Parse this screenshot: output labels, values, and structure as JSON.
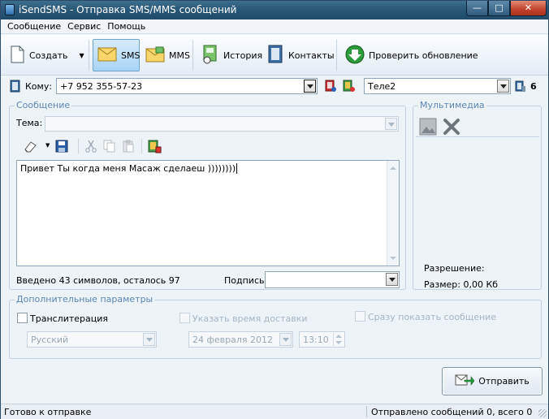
{
  "window": {
    "title": "iSendSMS - Отправка SMS/MMS сообщений",
    "controls": [
      "minimize-icon",
      "maximize-icon",
      "close-icon"
    ]
  },
  "menu": [
    "Сообщение",
    "Сервис",
    "Помощь"
  ],
  "toolbar": {
    "create": "Создать",
    "sms": "SMS",
    "mms": "MMS",
    "history": "История",
    "contacts": "Контакты",
    "update": "Проверить обновление"
  },
  "recipient": {
    "label": "Кому:",
    "value": "+7 952 355-57-23",
    "operator": "Теле2",
    "count": "6"
  },
  "message": {
    "group_title": "Сообщение",
    "subject_label": "Тема:",
    "subject_value": "",
    "text": "Привет Ты когда меня Масаж сделаеш ))))))))",
    "counter": "Введено 43 символов, осталось 97",
    "signature_label": "Подпись",
    "signature_value": ""
  },
  "multimedia": {
    "group_title": "Мультимедиа",
    "resolution_label": "Разрешение:",
    "size_label": "Размер: 0,00 Кб"
  },
  "extra": {
    "group_title": "Дополнительные параметры",
    "translit_label": "Транслитерация",
    "language_value": "Русский",
    "delivery_time_label": "Указать время доставки",
    "date_value": "24 февраля  2012",
    "time_value": "13:10",
    "flash_label": "Сразу показать сообщение"
  },
  "send_button": "Отправить",
  "status": {
    "left": "Готово к отправке",
    "right": "Отправлено сообщений 0, всего 0"
  }
}
